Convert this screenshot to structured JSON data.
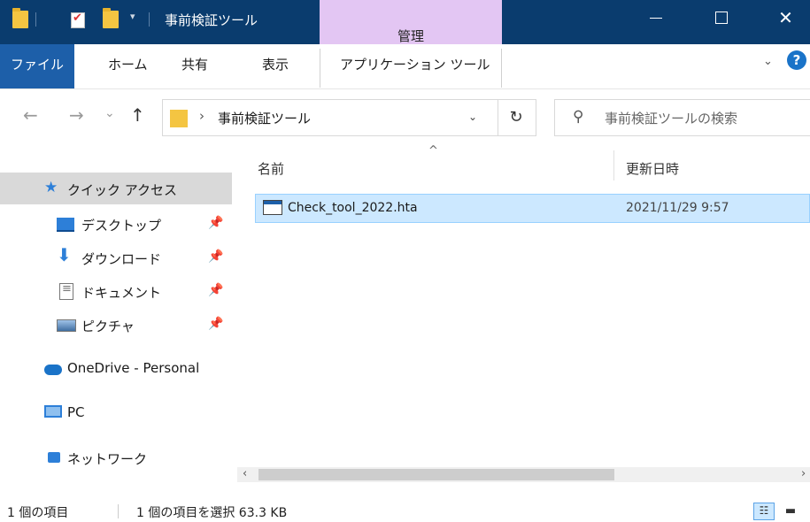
{
  "window": {
    "title": "事前検証ツール",
    "context_tab": "管理",
    "controls": {
      "minimize": "—",
      "maximize": "",
      "close": "✕"
    }
  },
  "ribbon": {
    "tabs": [
      "ファイル",
      "ホーム",
      "共有",
      "表示",
      "アプリケーション ツール"
    ],
    "help": "?"
  },
  "address": {
    "back": "←",
    "forward": "→",
    "recent": "⌄",
    "up": "↑",
    "separator": "›",
    "path": "事前検証ツール",
    "dropdown": "⌄",
    "refresh": "↻",
    "search_placeholder": "事前検証ツールの検索"
  },
  "sidebar": {
    "quick_access": "クイック アクセス",
    "items": [
      {
        "label": "デスクトップ",
        "icon": "desktop-icon",
        "pinned": true
      },
      {
        "label": "ダウンロード",
        "icon": "download-icon",
        "pinned": true
      },
      {
        "label": "ドキュメント",
        "icon": "documents-icon",
        "pinned": true
      },
      {
        "label": "ピクチャ",
        "icon": "pictures-icon",
        "pinned": true
      }
    ],
    "onedrive": "OneDrive - Personal",
    "pc": "PC",
    "network": "ネットワーク",
    "pin_glyph": "📌"
  },
  "columns": {
    "name": "名前",
    "modified": "更新日時",
    "sort_indicator": "^"
  },
  "files": [
    {
      "name": "Check_tool_2022.hta",
      "modified": "2021/11/29 9:57",
      "selected": true
    }
  ],
  "status": {
    "item_count": "1 個の項目",
    "selection": "1 個の項目を選択  63.3 KB"
  },
  "colors": {
    "titlebar": "#0a3c6e",
    "context_tab": "#e3c6f3",
    "file_tab": "#1d5fa9",
    "selection": "#cce8ff"
  }
}
